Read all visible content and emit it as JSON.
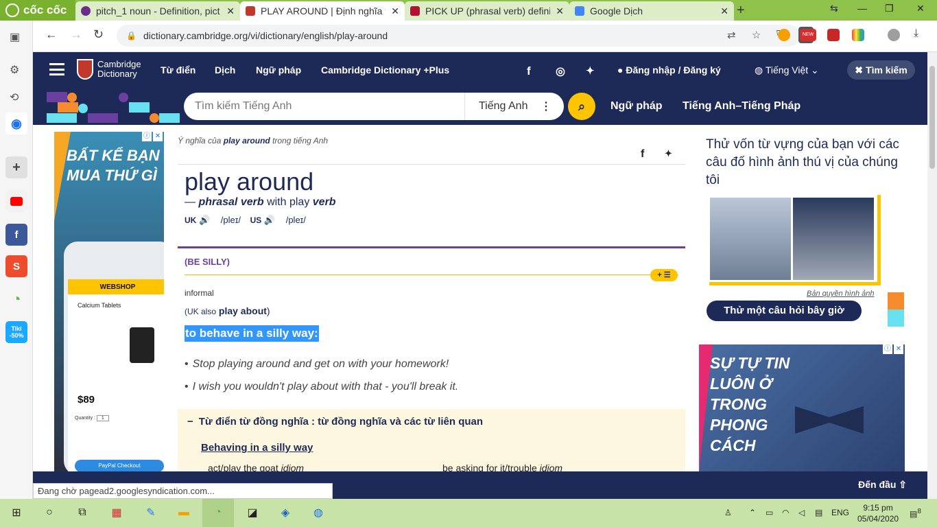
{
  "browser": {
    "brand": "cốc cốc",
    "tabs": [
      {
        "title": "pitch_1 noun - Definition, pict",
        "favicon_color": "#6b2d8c"
      },
      {
        "title": "PLAY AROUND | Định nghĩa tr",
        "favicon_color": "#c0392b"
      },
      {
        "title": "PICK UP (phrasal verb) definiti",
        "favicon_color": "#b3122e"
      },
      {
        "title": "Google Dịch",
        "favicon_color": "#4285f4"
      }
    ],
    "url": "dictionary.cambridge.org/vi/dictionary/english/play-around",
    "ext_badge": "NEW",
    "status": "Đang chờ pagead2.googlesyndication.com..."
  },
  "sidebar": {
    "badges": [
      "Tiki",
      "-50%"
    ]
  },
  "site": {
    "logo_line1": "Cambridge",
    "logo_line2": "Dictionary",
    "nav": [
      "Từ điển",
      "Dịch",
      "Ngữ pháp",
      "Cambridge Dictionary +Plus"
    ],
    "login": "Đăng nhập / Đăng ký",
    "language": "Tiếng Việt",
    "search_button": "Tìm kiếm",
    "search_placeholder": "Tìm kiếm Tiếng Anh",
    "search_lang": "Tiếng Anh",
    "links": [
      "Ngữ pháp",
      "Tiếng Anh–Tiếng Pháp"
    ]
  },
  "ad_left": {
    "headline": "BẤT KỂ BẠN MUA THỨ GÌ",
    "shop": "WEBSHOP",
    "product": "Calcium Tablets",
    "price": "$89",
    "qty_label": "Quantity :",
    "qty": "1",
    "paypal": "PayPal Checkout"
  },
  "entry": {
    "crumb_pre": "Ý nghĩa của",
    "crumb_word": "play around",
    "crumb_post": "trong tiếng Anh",
    "headword": "play around",
    "pos_dash": "—",
    "pos": "phrasal verb",
    "pos_with": "with play",
    "pos_verb": "verb",
    "uk": "UK",
    "uk_ipa": "/pleɪ/",
    "us": "US",
    "us_ipa": "/pleɪ/",
    "guideword": "(BE SILLY)",
    "plus": "+ ☰",
    "register": "informal",
    "uk_also_pre": "(UK also",
    "uk_also_word": "play about",
    "uk_also_post": ")",
    "definition": "to behave in a silly way:",
    "examples": [
      "Stop playing around and get on with your homework!",
      "I wish you wouldn't play about with that - you'll break it."
    ],
    "thesaurus_title": "Từ điển từ đồng nghĩa : từ đồng nghĩa và các từ liên quan",
    "thesaurus_sub": "Behaving in a silly way",
    "related": [
      {
        "text": "act/play the goat",
        "tag": "idiom"
      },
      {
        "text": "be asking for it/trouble",
        "tag": "idiom"
      }
    ]
  },
  "quiz": {
    "text": "Thử vốn từ vựng của bạn với các câu đố hình ảnh thú vị của chúng tôi",
    "credit": "Bản quyền hình ảnh",
    "button": "Thử một câu hỏi bây giờ"
  },
  "ad_right": {
    "headline": "SỰ TỰ TIN LUÔN Ở TRONG PHONG CÁCH"
  },
  "footer": {
    "to_top": "Đến đầu"
  },
  "taskbar": {
    "lang": "ENG",
    "time": "9:15 pm",
    "date": "05/04/2020",
    "notif_count": "8"
  }
}
